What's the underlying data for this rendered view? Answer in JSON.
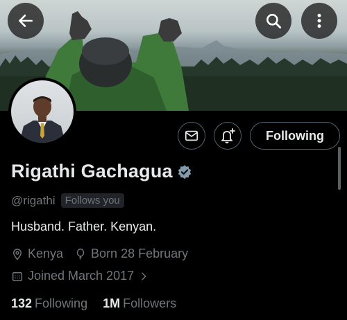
{
  "profile": {
    "name": "Rigathi Gachagua",
    "handle": "@rigathi",
    "follows_you": "Follows you",
    "bio": "Husband. Father. Kenyan.",
    "location": "Kenya",
    "birthday": "Born 28 February",
    "joined": "Joined March 2017",
    "following_count": "132",
    "following_label": "Following",
    "followers_count": "1M",
    "followers_label": "Followers"
  },
  "actions": {
    "follow_state_label": "Following"
  },
  "icons": {
    "back": "arrow-left-icon",
    "search": "search-icon",
    "more": "more-vertical-icon",
    "message": "envelope-icon",
    "notify": "bell-plus-icon",
    "verified": "verified-badge-icon",
    "location": "location-pin-icon",
    "birthday": "balloon-icon",
    "joined": "calendar-icon",
    "chevron": "chevron-right-icon"
  },
  "colors": {
    "background": "#000000",
    "text": "#e7e9ea",
    "secondary_text": "#71767b",
    "border": "#536471",
    "verified": "#829aab"
  }
}
